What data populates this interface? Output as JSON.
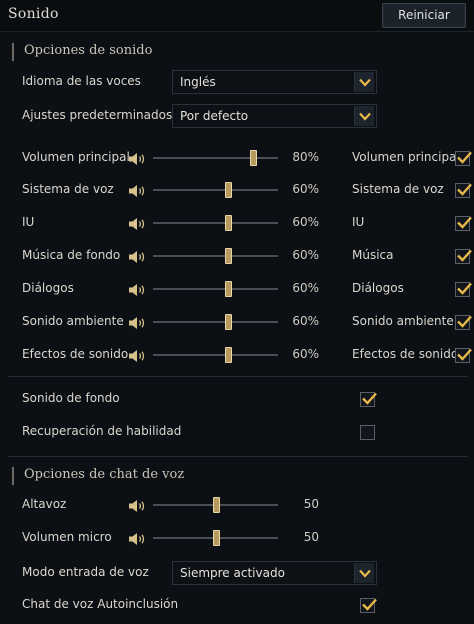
{
  "header": {
    "title": "Sonido",
    "reset_label": "Reiniciar"
  },
  "sound_section": {
    "title": "Opciones de sonido",
    "voice_language": {
      "label": "Idioma de las voces",
      "value": "Inglés"
    },
    "presets": {
      "label": "Ajustes predeterminados",
      "value": "Por defecto"
    },
    "volumes": [
      {
        "label": "Volumen principal",
        "value": "80%",
        "level": 0.8,
        "toggle_label": "Volumen principal",
        "checked": true
      },
      {
        "label": "Sistema de voz",
        "value": "60%",
        "level": 0.6,
        "toggle_label": "Sistema de voz",
        "checked": true
      },
      {
        "label": "IU",
        "value": "60%",
        "level": 0.6,
        "toggle_label": "IU",
        "checked": true
      },
      {
        "label": "Música de fondo",
        "value": "60%",
        "level": 0.6,
        "toggle_label": "Música",
        "checked": true
      },
      {
        "label": "Diálogos",
        "value": "60%",
        "level": 0.6,
        "toggle_label": "Diálogos",
        "checked": true
      },
      {
        "label": "Sonido ambiente",
        "value": "60%",
        "level": 0.6,
        "toggle_label": "Sonido ambiente",
        "checked": true
      },
      {
        "label": "Efectos de sonido",
        "value": "60%",
        "level": 0.6,
        "toggle_label": "Efectos de sonido",
        "checked": true
      }
    ],
    "background_sound": {
      "label": "Sonido de fondo",
      "checked": true
    },
    "skill_recovery": {
      "label": "Recuperación de habilidad",
      "checked": false
    }
  },
  "voice_chat_section": {
    "title": "Opciones de chat de voz",
    "speaker": {
      "label": "Altavoz",
      "value": "50",
      "level": 0.5
    },
    "mic": {
      "label": "Volumen micro",
      "value": "50",
      "level": 0.5
    },
    "input_mode": {
      "label": "Modo entrada de voz",
      "value": "Siempre activado"
    },
    "auto_join": {
      "label": "Chat de voz Autoinclusión",
      "checked": true
    }
  },
  "colors": {
    "accent": "#e7b84a",
    "handle": "#b79a60",
    "background": "#0c1014"
  },
  "icons": {
    "speaker": "speaker-icon",
    "dropdown": "chevron-down-icon",
    "check": "checkmark-icon"
  }
}
